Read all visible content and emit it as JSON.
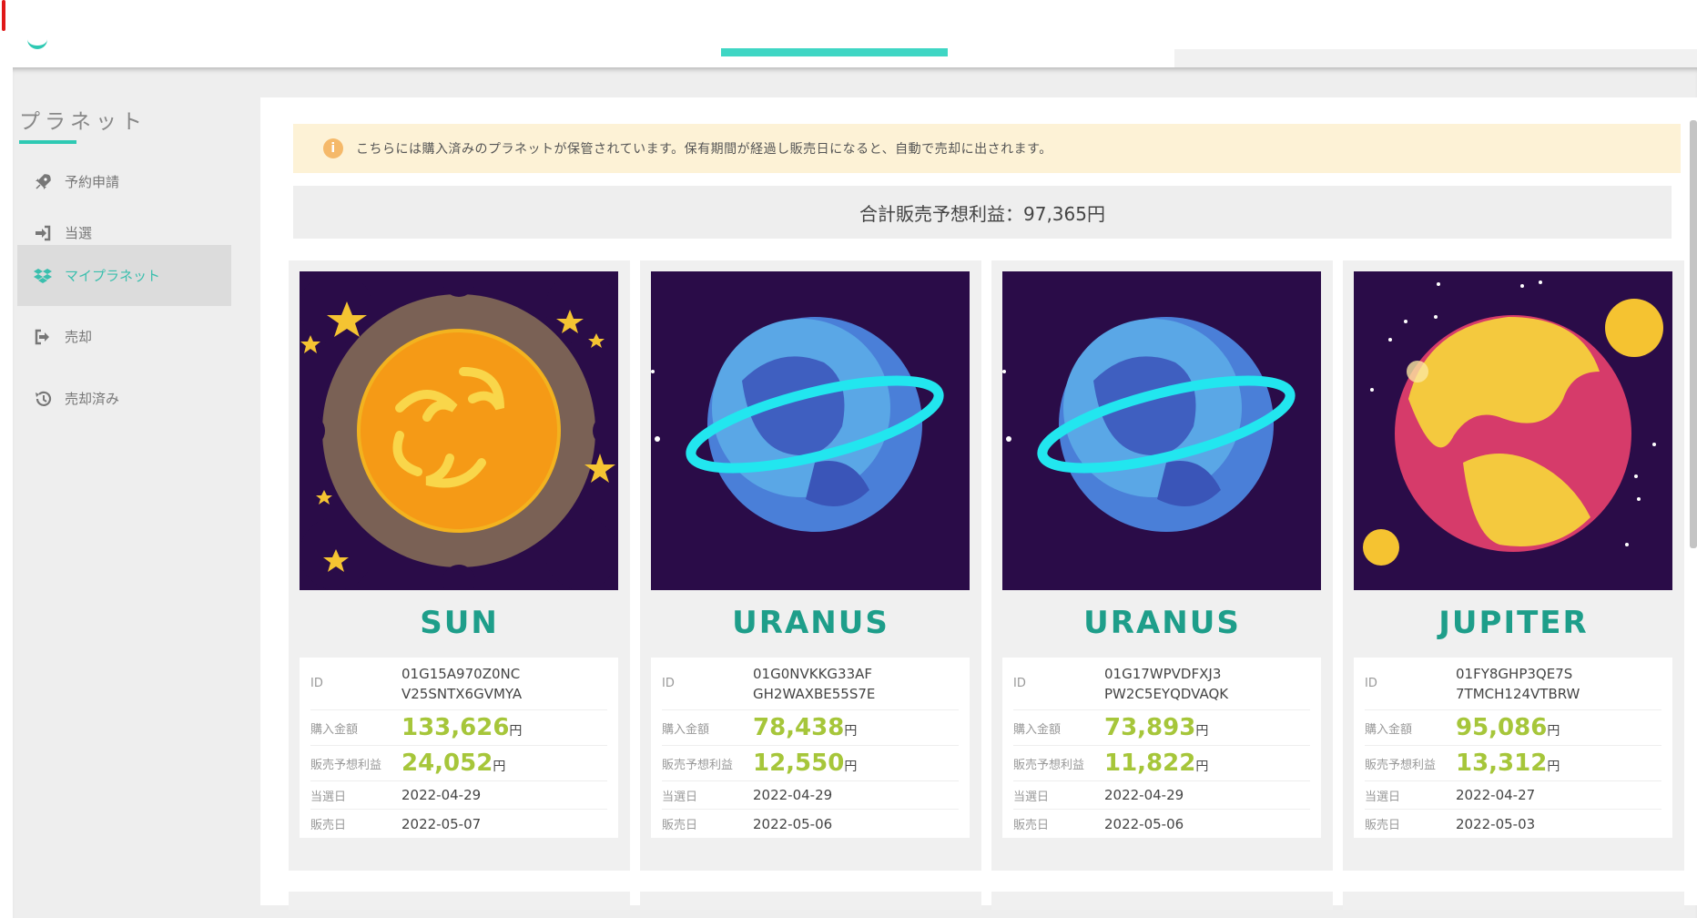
{
  "sidebar": {
    "title": "プラネット",
    "items": [
      {
        "label": "予約申請",
        "icon": "rocket-icon"
      },
      {
        "label": "当選",
        "icon": "sign-in-icon"
      },
      {
        "label": "マイプラネット",
        "icon": "dropbox-icon"
      },
      {
        "label": "売却",
        "icon": "sign-out-icon"
      },
      {
        "label": "売却済み",
        "icon": "history-icon"
      }
    ],
    "active_index": 2
  },
  "notice": {
    "icon": "info-icon",
    "text": "こちらには購入済みのプラネットが保管されています。保有期間が経過し販売日になると、自動で売却に出されます。"
  },
  "total": {
    "text": "合計販売予想利益：97,365円"
  },
  "labels": {
    "id": "ID",
    "purchase": "購入金額",
    "profit": "販売予想利益",
    "won_date": "当選日",
    "sale_date": "販売日",
    "yen": "円"
  },
  "planets": [
    {
      "name": "SUN",
      "id_line1": "01G15A970Z0NC",
      "id_line2": "V25SNTX6GVMYA",
      "purchase": "133,626",
      "profit": "24,052",
      "won_date": "2022-04-29",
      "sale_date": "2022-05-07"
    },
    {
      "name": "URANUS",
      "id_line1": "01G0NVKKG33AF",
      "id_line2": "GH2WAXBE55S7E",
      "purchase": "78,438",
      "profit": "12,550",
      "won_date": "2022-04-29",
      "sale_date": "2022-05-06"
    },
    {
      "name": "URANUS",
      "id_line1": "01G17WPVDFXJ3",
      "id_line2": "PW2C5EYQDVAQK",
      "purchase": "73,893",
      "profit": "11,822",
      "won_date": "2022-04-29",
      "sale_date": "2022-05-06"
    },
    {
      "name": "JUPITER",
      "id_line1": "01FY8GHP3QE7S",
      "id_line2": "7TMCH124VTBRW",
      "purchase": "95,086",
      "profit": "13,312",
      "won_date": "2022-04-27",
      "sale_date": "2022-05-03"
    }
  ],
  "colors": {
    "accent": "#2ec9b3",
    "planet_name": "#1e9e8a",
    "price": "#a6c63a",
    "notice_bg": "#fdf2d6",
    "image_bg": "#2a0c48"
  }
}
